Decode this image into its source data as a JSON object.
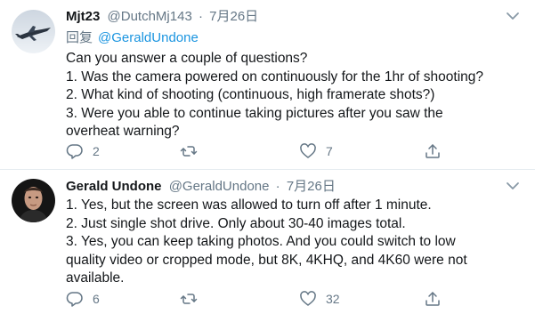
{
  "colors": {
    "text": "#14171a",
    "secondary": "#657786",
    "link": "#1b95e0",
    "divider": "#e6ecf0"
  },
  "tweets": [
    {
      "display_name": "Mjt23",
      "handle": "@DutchMj143",
      "separator": "·",
      "time": "7月26日",
      "reply_prefix": "回复",
      "reply_to": "@GeraldUndone",
      "lines": [
        "Can you answer a couple of questions?",
        "1. Was the camera powered on continuously for the 1hr of shooting?",
        "2. What kind of shooting (continuous, high framerate shots?)",
        "3. Were you able to continue taking pictures after you saw the",
        "overheat warning?"
      ],
      "actions": {
        "reply_count": "2",
        "retweet_count": "",
        "like_count": "7"
      },
      "icons": [
        "reply-icon",
        "retweet-icon",
        "heart-icon",
        "share-icon",
        "chevron-down-icon"
      ]
    },
    {
      "display_name": "Gerald Undone",
      "handle": "@GeraldUndone",
      "separator": "·",
      "time": "7月26日",
      "lines": [
        "1. Yes, but the screen was allowed to turn off after 1 minute.",
        "2. Just single shot drive. Only about 30-40 images total.",
        "3. Yes, you can keep taking photos. And you could switch to low",
        "quality video or cropped mode, but 8K, 4KHQ, and 4K60 were not",
        "available."
      ],
      "actions": {
        "reply_count": "6",
        "retweet_count": "",
        "like_count": "32"
      },
      "icons": [
        "reply-icon",
        "retweet-icon",
        "heart-icon",
        "share-icon",
        "chevron-down-icon"
      ]
    }
  ]
}
